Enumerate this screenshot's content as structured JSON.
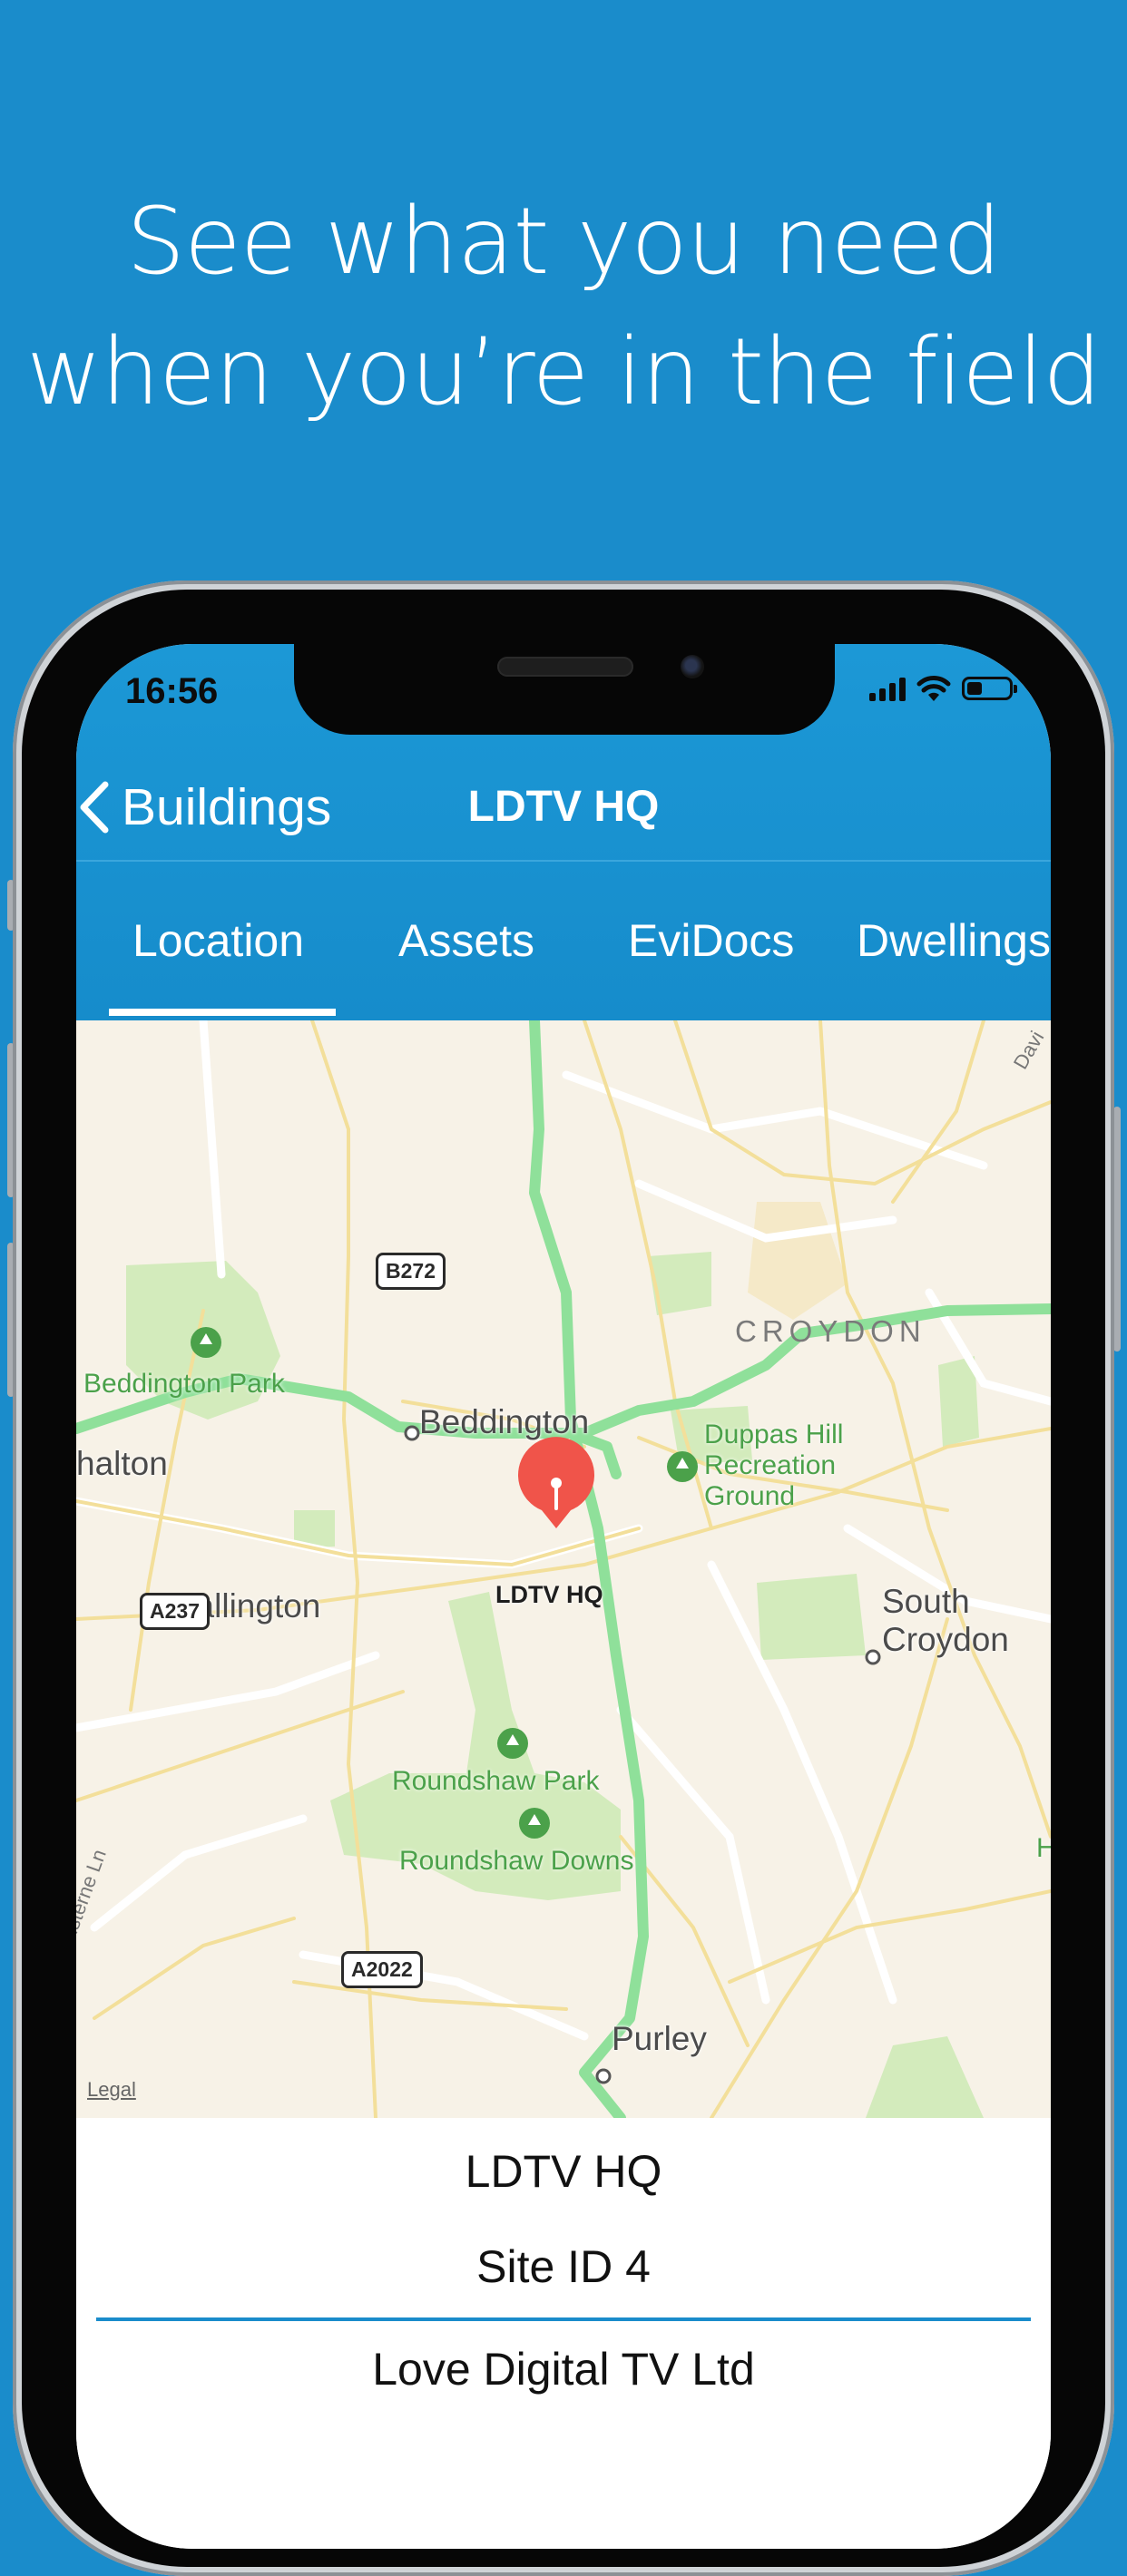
{
  "headline": {
    "line1": "See what you need",
    "line2": "when you’re in the field"
  },
  "status_bar": {
    "time": "16:56",
    "icons": [
      "cellular-signal-icon",
      "wifi-icon",
      "battery-icon"
    ]
  },
  "nav": {
    "back_label": "Buildings",
    "title": "LDTV HQ"
  },
  "tabs": [
    {
      "label": "Location",
      "selected": true
    },
    {
      "label": "Assets",
      "selected": false
    },
    {
      "label": "EviDocs",
      "selected": false
    },
    {
      "label": "Dwellings",
      "selected": false
    }
  ],
  "map": {
    "pin_label": "LDTV HQ",
    "places": [
      "Beddington",
      "Wallington",
      "halton",
      "South Croydon",
      "Purley"
    ],
    "district": "CROYDON",
    "parks": [
      "Beddington Park",
      "Duppas Hill Recreation Ground",
      "Roundshaw Park",
      "Roundshaw Downs"
    ],
    "duppas_lines": [
      "Duppas Hill",
      "Recreation",
      "Ground"
    ],
    "south_croydon_lines": [
      "South",
      "Croydon"
    ],
    "roads": [
      "B272",
      "A237",
      "A2022"
    ],
    "street": "odmansterne Ln",
    "edge_labels": [
      "Davi",
      "H"
    ],
    "legal": "Legal"
  },
  "info": {
    "name": "LDTV HQ",
    "site_id": "Site ID 4",
    "company": "Love Digital TV Ltd"
  },
  "colors": {
    "background": "#1a8ccb",
    "nav": "#168ccb",
    "map_land": "#f7f2e7",
    "park": "#cfe8b5",
    "major_road": "#8fe09a",
    "pin": "#f0544a"
  }
}
